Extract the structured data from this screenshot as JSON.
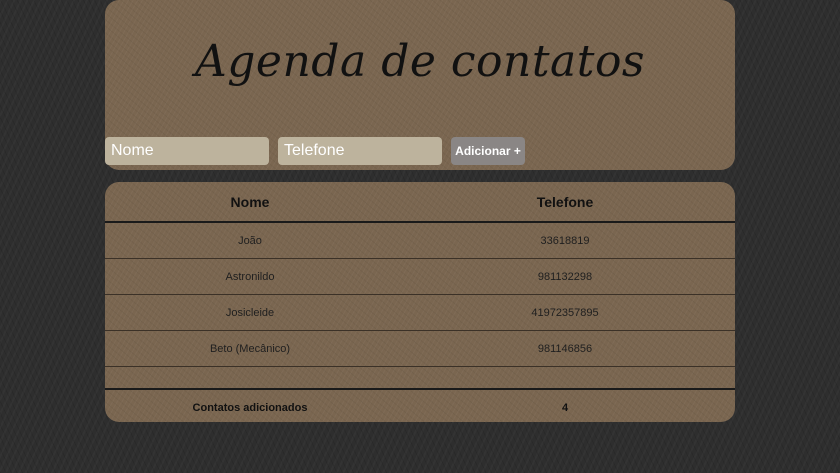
{
  "header": {
    "title": "Agenda de contatos"
  },
  "form": {
    "name_placeholder": "Nome",
    "phone_placeholder": "Telefone",
    "add_label": "Adicionar +"
  },
  "table": {
    "headers": [
      "Nome",
      "Telefone"
    ],
    "rows": [
      {
        "name": "João",
        "phone": "33618819"
      },
      {
        "name": "Astronildo",
        "phone": "981132298"
      },
      {
        "name": "Josicleide",
        "phone": "41972357895"
      },
      {
        "name": "Beto (Mecânico)",
        "phone": "981146856"
      }
    ],
    "footer": {
      "label": "Contatos adicionados",
      "count": "4"
    }
  }
}
